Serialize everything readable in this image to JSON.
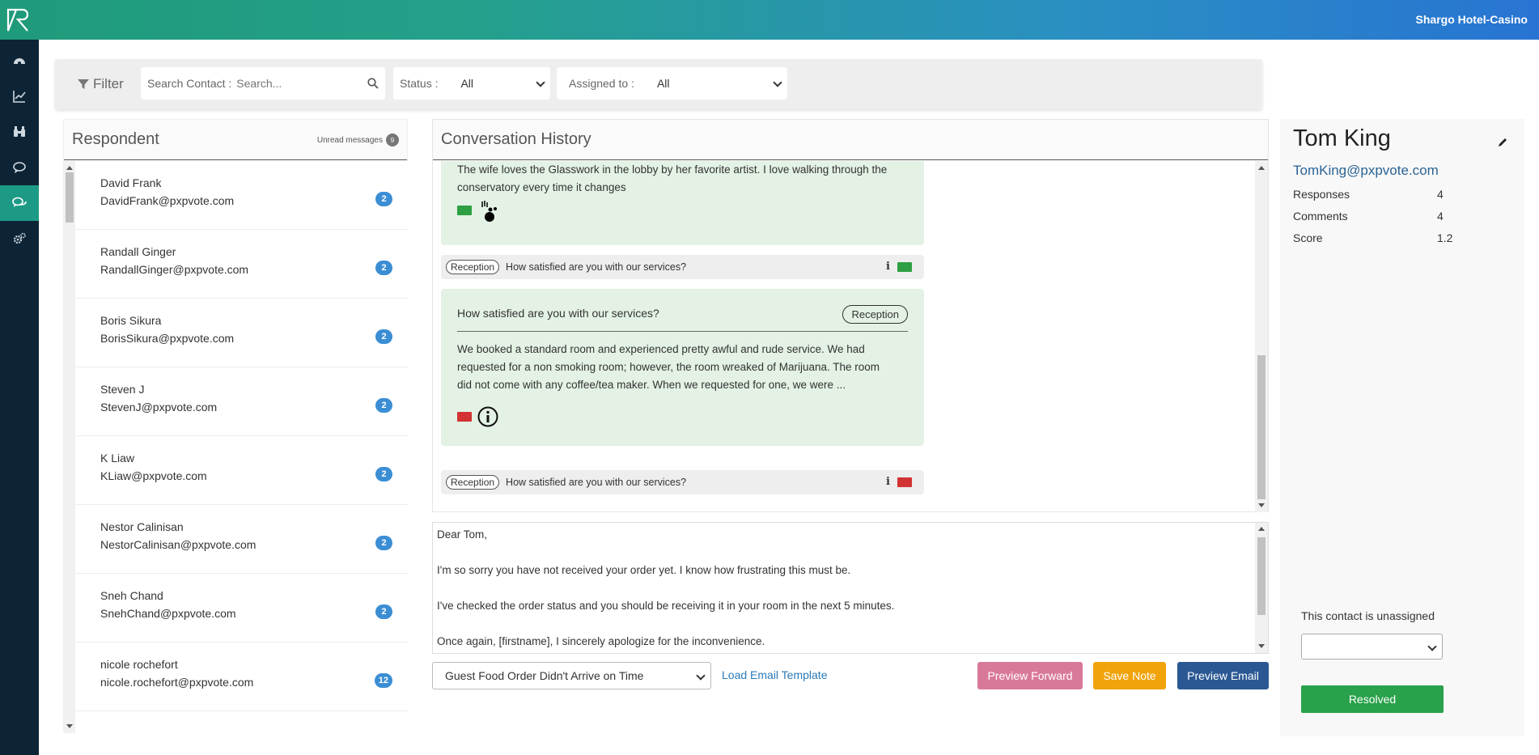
{
  "header": {
    "property_name": "Shargo Hotel-Casino"
  },
  "sidebar": {
    "items": [
      {
        "icon": "dashboard-icon"
      },
      {
        "icon": "chart-line-icon"
      },
      {
        "icon": "binoculars-icon"
      },
      {
        "icon": "comment-icon"
      },
      {
        "icon": "comments-icon",
        "active": true
      },
      {
        "icon": "cogs-icon"
      }
    ]
  },
  "filter": {
    "label": "Filter",
    "search_label": "Search Contact :",
    "search_placeholder": "Search...",
    "status_label": "Status :",
    "status_value": "All",
    "assigned_label": "Assigned to :",
    "assigned_value": "All"
  },
  "respondents": {
    "title": "Respondent",
    "unread_label": "Unread messages",
    "unread_count": "9",
    "items": [
      {
        "name": "David Frank",
        "email": "DavidFrank@pxpvote.com",
        "count": "2"
      },
      {
        "name": "Randall Ginger",
        "email": "RandallGinger@pxpvote.com",
        "count": "2"
      },
      {
        "name": "Boris Sikura",
        "email": "BorisSikura@pxpvote.com",
        "count": "2"
      },
      {
        "name": "Steven J",
        "email": "StevenJ@pxpvote.com",
        "count": "2"
      },
      {
        "name": "K Liaw",
        "email": "KLiaw@pxpvote.com",
        "count": "2"
      },
      {
        "name": "Nestor Calinisan",
        "email": "NestorCalinisan@pxpvote.com",
        "count": "2"
      },
      {
        "name": "Sneh Chand",
        "email": "SnehChand@pxpvote.com",
        "count": "2"
      },
      {
        "name": "nicole rochefort",
        "email": "nicole.rochefort@pxpvote.com",
        "count": "12"
      }
    ]
  },
  "conversation": {
    "title": "Conversation History",
    "bubble1_line1": "The wife loves the Glasswork in the lobby by her favorite artist. I love walking through the",
    "bubble1_line2": "conservatory every time it changes",
    "q1": {
      "tag": "Reception",
      "question": "How satisfied are you with our services?",
      "info": "i"
    },
    "bubble2": {
      "question": "How satisfied are you with our services?",
      "tag": "Reception",
      "line1": "We booked a standard room and experienced pretty awful and rude service. We had",
      "line2": "requested for a non smoking room; however, the room wreaked of Marijuana. The room",
      "line3": "did not come with any coffee/tea maker. When we requested for one, we were ..."
    },
    "q2": {
      "tag": "Reception",
      "question": "How satisfied are you with our services?",
      "info": "i"
    }
  },
  "email": {
    "line1": "Dear Tom,",
    "line2": "I'm so sorry you have not received your order yet. I know how frustrating this must be.",
    "line3": "I've checked the order status and you should be receiving it in your room in the next 5 minutes.",
    "line4": "Once again, [firstname], I sincerely apologize for the inconvenience."
  },
  "actions": {
    "template_value": "Guest Food Order Didn't Arrive on Time",
    "load_template": "Load Email Template",
    "preview_forward": "Preview Forward",
    "save_note": "Save Note",
    "preview_email": "Preview Email"
  },
  "contact": {
    "name": "Tom King",
    "email": "TomKing@pxpvote.com",
    "responses_label": "Responses",
    "responses_value": "4",
    "comments_label": "Comments",
    "comments_value": "4",
    "score_label": "Score",
    "score_value": "1.2",
    "unassigned_text": "This contact is unassigned",
    "resolved_label": "Resolved"
  },
  "colors": {
    "accent": "#1d9a86",
    "sidebar": "#0d2436",
    "badge": "#3b8ed4",
    "green_face": "#2ea043",
    "red_face": "#d23232"
  }
}
